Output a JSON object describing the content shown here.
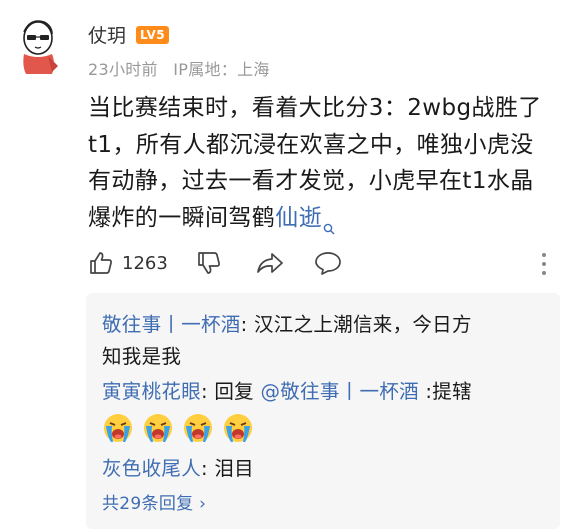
{
  "comment": {
    "username": "仗玥",
    "level_badge": "LV5",
    "time": "23小时前",
    "ip_location": "IP属地：上海",
    "text_lines": [
      "当比赛结束时，看着大比分3：2wbg战胜了",
      "t1，所有人都沉浸在欢喜之中，唯独小虎没",
      "有动静，过去一看才发觉，小虎早在t1水晶",
      "爆炸的一瞬间驾鹤"
    ],
    "link_text": "仙逝",
    "like_count": "1263"
  },
  "replies": {
    "reply1": {
      "author": "敬往事丨一杯酒",
      "text_line1": ": 汉江之上潮信来，今日方",
      "text_line2": "知我是我"
    },
    "reply2": {
      "author": "寅寅桃花眼",
      "prefix": ": 回复 ",
      "mention": "@敬往事丨一杯酒",
      "suffix": " :提辖",
      "emoji_count": 4
    },
    "reply3": {
      "author": "灰色收尾人",
      "text": ": 泪目"
    },
    "more_label": "共29条回复",
    "more_chevron": "›"
  },
  "colors": {
    "link": "#3f6db3",
    "badge": "#ff8c1a",
    "meta": "#999999",
    "reply_bg": "#f6f6f6"
  },
  "icons": [
    "thumbs-up-icon",
    "thumbs-down-icon",
    "share-icon",
    "comment-icon",
    "more-vertical-icon",
    "search-icon",
    "crying-emoji-icon"
  ]
}
